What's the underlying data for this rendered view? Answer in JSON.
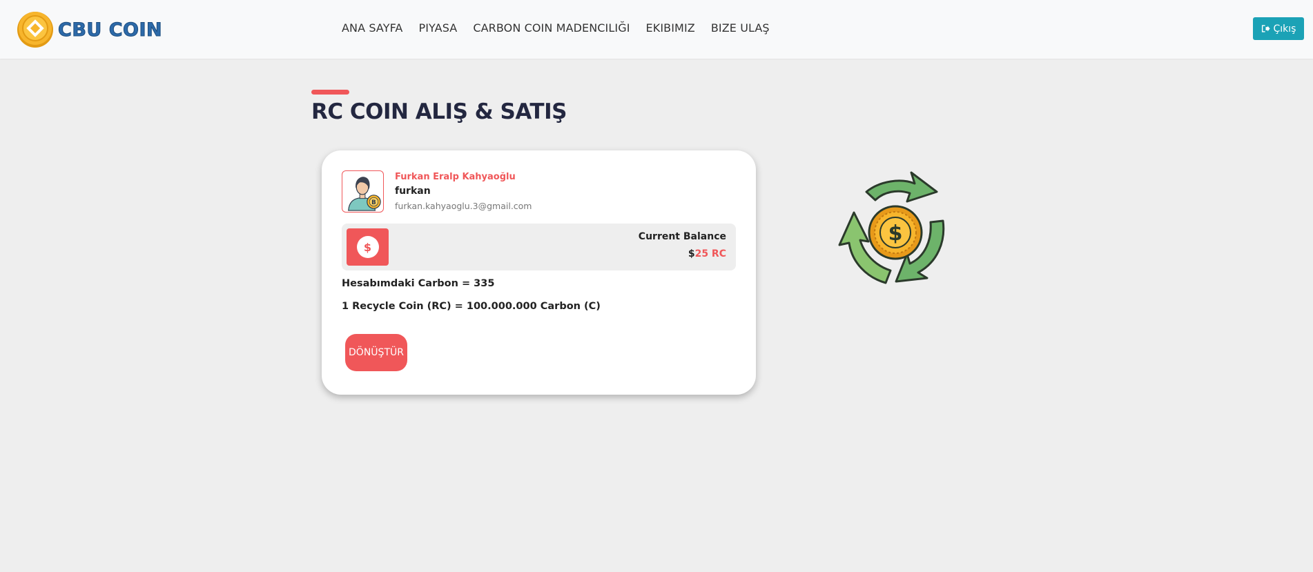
{
  "brand": {
    "name": "CBU COIN"
  },
  "nav": {
    "items": [
      {
        "label": "ANA SAYFA"
      },
      {
        "label": "PIYASA"
      },
      {
        "label": "CARBON COIN MADENCILIĞI"
      },
      {
        "label": "EKIBIMIZ"
      },
      {
        "label": "BIZE ULAŞ"
      }
    ]
  },
  "header": {
    "logout_label": "Çıkış"
  },
  "page": {
    "title": "RC COIN ALIŞ & SATIŞ"
  },
  "user": {
    "full_name": "Furkan Eralp Kahyaoğlu",
    "username": "furkan",
    "email": "furkan.kahyaoglu.3@gmail.com"
  },
  "balance": {
    "icon_symbol": "$",
    "label": "Current Balance",
    "currency": "$",
    "amount": "25 RC"
  },
  "carbon": {
    "text": "Hesabımdaki Carbon = 335"
  },
  "rate": {
    "text": "1 Recycle Coin (RC) = 100.000.000 Carbon (C)"
  },
  "action": {
    "convert_label": "DÖNÜŞTÜR"
  },
  "colors": {
    "accent": "#f05759",
    "navy": "#232740",
    "logout": "#1ba2b6",
    "coin_gold": "#f7b52c",
    "recycle_green": "#6db36a"
  },
  "icons": {
    "brand": "coin-logo-icon",
    "logout": "sign-out-icon",
    "avatar": "user-bitcoin-avatar-icon",
    "balance": "dollar-icon",
    "illustration": "recycle-coin-icon"
  }
}
